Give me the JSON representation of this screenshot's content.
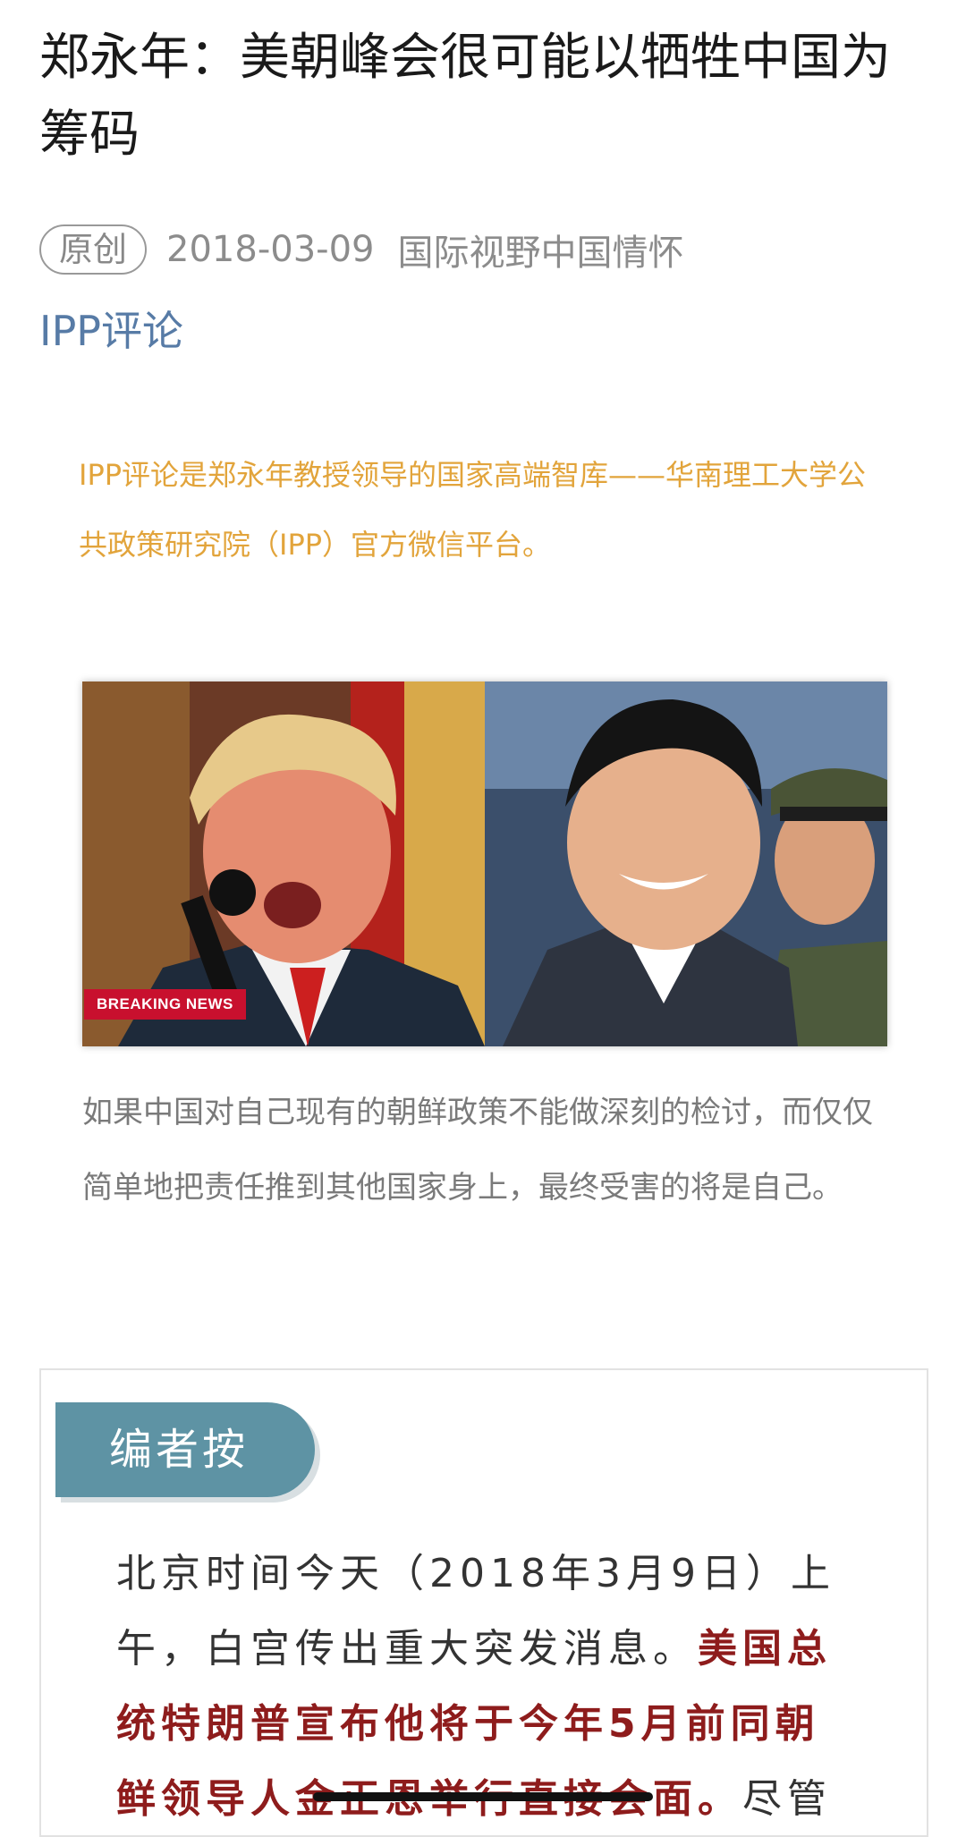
{
  "article": {
    "title": "郑永年：美朝峰会很可能以牺牲中国为筹码",
    "badge": "原创",
    "date": "2018-03-09",
    "source": "国际视野中国情怀",
    "account": "IPP评论"
  },
  "intro": {
    "text": "IPP评论是郑永年教授领导的国家高端智库——华南理工大学公共政策研究院（IPP）官方微信平台。"
  },
  "photo": {
    "breaking_label": "BREAKING NEWS"
  },
  "caption": {
    "text": "如果中国对自己现有的朝鲜政策不能做深刻的检讨，而仅仅简单地把责任推到其他国家身上，最终受害的将是自己。"
  },
  "editor": {
    "label": "编者按",
    "text_plain": "北京时间今天（2018年3月9日）上午，白宫传出重大突发消息。",
    "text_highlight": "美国总统特朗普宣布他将于今年5月前同朝鲜领导人金正恩举行直接会面。",
    "text_tail": "尽管"
  },
  "colors": {
    "intro": "#e2a43b",
    "account": "#577ba6",
    "editor_tab": "#5e93a4",
    "highlight": "#8e1c1c"
  }
}
